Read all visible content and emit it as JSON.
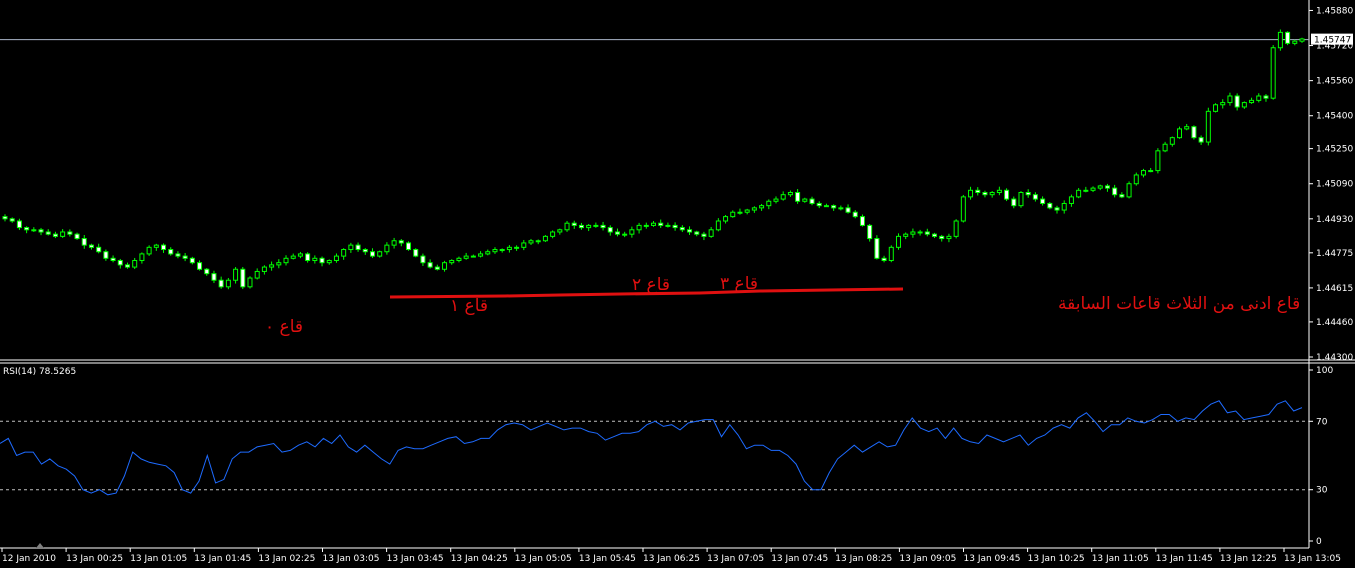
{
  "colors": {
    "background": "#000000",
    "frame": "#ffffff",
    "candle_bull": "#00ff00",
    "candle_bear_body": "#ffffff",
    "rsi_line": "#1e6bff",
    "level_line": "#c0c0c0",
    "annotation": "#e01010",
    "price_line": "#aab4c8"
  },
  "chart_data": [
    {
      "type": "candlestick",
      "current_price": "1.45747",
      "ylim": [
        1.443,
        1.458
      ],
      "y_ticks": [
        "1.45880",
        "1.45720",
        "1.45560",
        "1.45400",
        "1.45250",
        "1.45090",
        "1.44930",
        "1.44775",
        "1.44615",
        "1.44460",
        "1.44300"
      ],
      "close_series": [
        1.4493,
        1.4492,
        1.4489,
        1.4488,
        1.4488,
        1.4487,
        1.4486,
        1.4485,
        1.4487,
        1.4486,
        1.4484,
        1.4481,
        1.448,
        1.4478,
        1.4475,
        1.4474,
        1.4472,
        1.4471,
        1.4474,
        1.4477,
        1.448,
        1.4481,
        1.4479,
        1.4477,
        1.4476,
        1.4475,
        1.4473,
        1.447,
        1.4468,
        1.4465,
        1.4462,
        1.4465,
        1.447,
        1.4462,
        1.4466,
        1.4469,
        1.4471,
        1.4472,
        1.4473,
        1.4475,
        1.4476,
        1.4477,
        1.4474,
        1.4475,
        1.4473,
        1.4474,
        1.4476,
        1.4479,
        1.4481,
        1.4479,
        1.4478,
        1.4476,
        1.4478,
        1.4481,
        1.4483,
        1.4482,
        1.4479,
        1.4476,
        1.4473,
        1.4471,
        1.447,
        1.4473,
        1.4474,
        1.4475,
        1.4476,
        1.4476,
        1.4477,
        1.4478,
        1.4479,
        1.4479,
        1.448,
        1.448,
        1.4482,
        1.4483,
        1.4483,
        1.4485,
        1.4487,
        1.4488,
        1.4491,
        1.449,
        1.4489,
        1.449,
        1.449,
        1.4489,
        1.4487,
        1.4486,
        1.4486,
        1.4488,
        1.449,
        1.449,
        1.4491,
        1.449,
        1.449,
        1.4489,
        1.4488,
        1.4487,
        1.4486,
        1.4485,
        1.4488,
        1.4492,
        1.4494,
        1.4496,
        1.4496,
        1.4497,
        1.4498,
        1.4499,
        1.4501,
        1.4502,
        1.4504,
        1.4505,
        1.4501,
        1.4502,
        1.45,
        1.4499,
        1.4499,
        1.4498,
        1.4498,
        1.4496,
        1.4494,
        1.449,
        1.4484,
        1.4475,
        1.4474,
        1.448,
        1.4485,
        1.4486,
        1.4487,
        1.4487,
        1.4486,
        1.4485,
        1.4484,
        1.4485,
        1.4492,
        1.4503,
        1.4506,
        1.4505,
        1.4504,
        1.4505,
        1.4506,
        1.4502,
        1.4499,
        1.4505,
        1.4504,
        1.4502,
        1.45,
        1.4498,
        1.4497,
        1.45,
        1.4503,
        1.4506,
        1.4506,
        1.4507,
        1.4508,
        1.4507,
        1.4504,
        1.4503,
        1.4509,
        1.4513,
        1.4515,
        1.4515,
        1.4524,
        1.4527,
        1.453,
        1.4534,
        1.4535,
        1.453,
        1.4528,
        1.4542,
        1.4545,
        1.4546,
        1.4549,
        1.4544,
        1.4546,
        1.4547,
        1.4549,
        1.4548,
        1.4571,
        1.4578,
        1.4573,
        1.4574,
        1.4575
      ]
    },
    {
      "type": "line",
      "title": "RSI(14) 78.5265",
      "ylim": [
        0,
        100
      ],
      "y_ticks": [
        "100",
        "70",
        "30",
        "0"
      ],
      "levels": [
        70,
        30
      ],
      "values": [
        57,
        60,
        50,
        52,
        52,
        45,
        48,
        44,
        42,
        38,
        30,
        28,
        30,
        27,
        28,
        38,
        52,
        48,
        46,
        45,
        44,
        40,
        30,
        28,
        35,
        50,
        34,
        36,
        48,
        52,
        52,
        55,
        56,
        57,
        52,
        53,
        56,
        58,
        55,
        60,
        57,
        62,
        55,
        52,
        56,
        52,
        48,
        45,
        53,
        55,
        54,
        54,
        56,
        58,
        60,
        61,
        57,
        58,
        60,
        60,
        65,
        68,
        69,
        68,
        65,
        67,
        69,
        67,
        65,
        66,
        66,
        64,
        63,
        59,
        61,
        63,
        63,
        64,
        68,
        70,
        67,
        68,
        65,
        69,
        70,
        71,
        71,
        61,
        68,
        62,
        54,
        56,
        56,
        53,
        53,
        50,
        45,
        35,
        30,
        30,
        40,
        48,
        52,
        56,
        52,
        55,
        58,
        55,
        56,
        65,
        72,
        66,
        64,
        66,
        60,
        66,
        60,
        58,
        57,
        62,
        60,
        58,
        60,
        62,
        56,
        60,
        62,
        66,
        68,
        66,
        72,
        75,
        70,
        64,
        68,
        68,
        72,
        70,
        69,
        71,
        74,
        74,
        70,
        72,
        71,
        76,
        80,
        82,
        75,
        76,
        71,
        72,
        73,
        74,
        80,
        82,
        76,
        78
      ]
    }
  ],
  "time_axis": [
    "12 Jan 2010",
    "13 Jan 00:25",
    "13 Jan 01:05",
    "13 Jan 01:45",
    "13 Jan 02:25",
    "13 Jan 03:05",
    "13 Jan 03:45",
    "13 Jan 04:25",
    "13 Jan 05:05",
    "13 Jan 05:45",
    "13 Jan 06:25",
    "13 Jan 07:05",
    "13 Jan 07:45",
    "13 Jan 08:25",
    "13 Jan 09:05",
    "13 Jan 09:45",
    "13 Jan 10:25",
    "13 Jan 11:05",
    "13 Jan 11:45",
    "13 Jan 12:25",
    "13 Jan 13:05"
  ],
  "annotations": {
    "bottom_0": "قاع ٠",
    "bottom_1": "قاع ١",
    "bottom_2": "قاع ٢",
    "bottom_3": "قاع ٣",
    "lowest": "قاع ادنى من الثلاث قاعات السابقة"
  }
}
